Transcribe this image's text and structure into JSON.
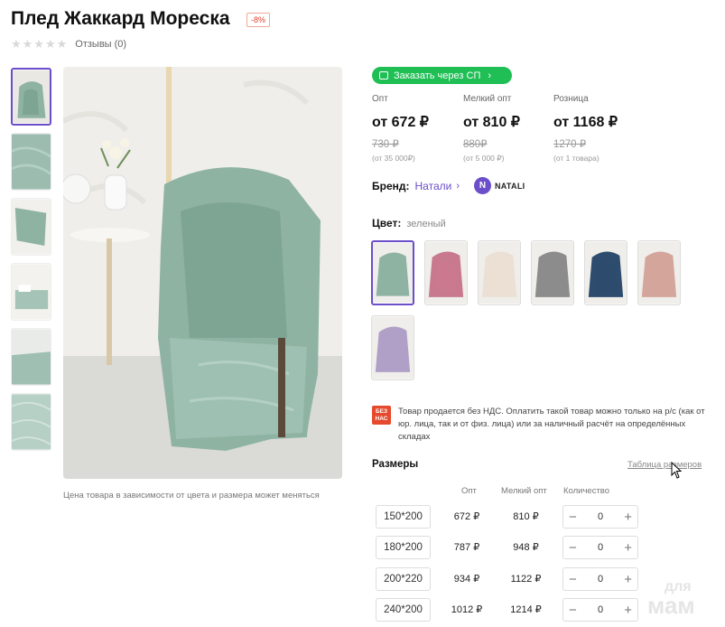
{
  "product": {
    "title": "Плед Жаккард Мореска",
    "discount": "-8%",
    "stars": "★★★★★",
    "reviews": "Отзывы (0)"
  },
  "image_note": "Цена товара в зависимости от цвета и размера может меняться",
  "order_button": {
    "label": "Заказать через СП",
    "icon": "bag-icon"
  },
  "prices": [
    {
      "label": "Опт",
      "now": "от 672 ₽",
      "old": "730 ₽",
      "min": "(от 35 000₽)"
    },
    {
      "label": "Мелкий опт",
      "now": "от 810 ₽",
      "old": "880₽",
      "min": "(от 5 000 ₽)"
    },
    {
      "label": "Розница",
      "now": "от 1168 ₽",
      "old": "1270 ₽",
      "min": "(от 1 товара)"
    }
  ],
  "brand": {
    "label": "Бренд:",
    "value": "Натали",
    "logo_letter": "N",
    "logo_text": "NATALI"
  },
  "color": {
    "label": "Цвет:",
    "value": "зеленый"
  },
  "swatches": [
    "#8fb3a3",
    "#c9798e",
    "#ece0d4",
    "#8c8c8c",
    "#2d4c6e",
    "#d4a59b",
    "#b0a0c8"
  ],
  "nds": {
    "badge": "БЕЗ НАС",
    "text": "Товар продается без НДС. Оплатить такой товар можно только на р/с (как от юр. лица, так и от физ. лица) или за наличный расчёт на определённых складах"
  },
  "sizes": {
    "title": "Размеры",
    "table_link": "Таблица размеров",
    "headers": {
      "opt": "Опт",
      "small_opt": "Мелкий опт",
      "qty": "Количество"
    },
    "rows": [
      {
        "size": "150*200",
        "opt": "672 ₽",
        "small": "810 ₽",
        "qty": "0"
      },
      {
        "size": "180*200",
        "opt": "787 ₽",
        "small": "948 ₽",
        "qty": "0"
      },
      {
        "size": "200*220",
        "opt": "934 ₽",
        "small": "1122 ₽",
        "qty": "0"
      },
      {
        "size": "240*200",
        "opt": "1012 ₽",
        "small": "1214 ₽",
        "qty": "0"
      }
    ],
    "minus": "−",
    "plus": "+"
  },
  "watermark": {
    "line1": "для",
    "line2": "мам"
  },
  "colors": {
    "accent": "#6b4ec9",
    "green": "#1fbf55",
    "blanket": "#8fb3a3"
  }
}
